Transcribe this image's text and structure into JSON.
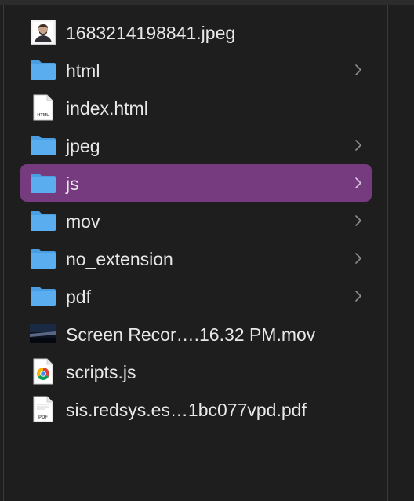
{
  "files": [
    {
      "name": "1683214198841.jpeg",
      "icon": "image-thumbnail-icon",
      "has_chevron": false,
      "selected": false
    },
    {
      "name": "html",
      "icon": "folder-icon",
      "has_chevron": true,
      "selected": false
    },
    {
      "name": "index.html",
      "icon": "html-document-icon",
      "has_chevron": false,
      "selected": false
    },
    {
      "name": "jpeg",
      "icon": "folder-icon",
      "has_chevron": true,
      "selected": false
    },
    {
      "name": "js",
      "icon": "folder-icon",
      "has_chevron": true,
      "selected": true
    },
    {
      "name": "mov",
      "icon": "folder-icon",
      "has_chevron": true,
      "selected": false
    },
    {
      "name": "no_extension",
      "icon": "folder-icon",
      "has_chevron": true,
      "selected": false
    },
    {
      "name": "pdf",
      "icon": "folder-icon",
      "has_chevron": true,
      "selected": false
    },
    {
      "name": "Screen Recor….16.32 PM.mov",
      "icon": "video-thumbnail-icon",
      "has_chevron": false,
      "selected": false
    },
    {
      "name": "scripts.js",
      "icon": "chrome-document-icon",
      "has_chevron": false,
      "selected": false
    },
    {
      "name": "sis.redsys.es…1bc077vpd.pdf",
      "icon": "pdf-document-icon",
      "has_chevron": false,
      "selected": false
    }
  ],
  "doc_labels": {
    "html": "HTML",
    "pdf": "PDF"
  },
  "colors": {
    "selection": "#763a7e",
    "folder": "#5aaef0",
    "folder_tab": "#4a9de0",
    "text": "#e8e8e8",
    "chevron": "#8e8e8e",
    "background": "#1e1e1e"
  }
}
